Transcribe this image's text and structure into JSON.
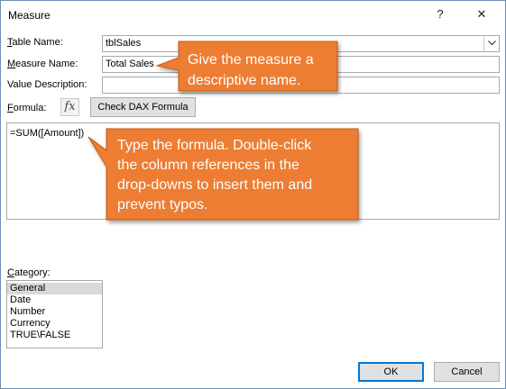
{
  "window": {
    "title": "Measure",
    "help_glyph": "?",
    "close_glyph": "✕"
  },
  "form": {
    "table_name": {
      "label_underlined": "T",
      "label_rest": "able Name:",
      "value": "tblSales"
    },
    "measure_name": {
      "label_underlined": "M",
      "label_rest": "easure Name:",
      "value": "Total Sales"
    },
    "value_description": {
      "label": "Value Description:",
      "value": ""
    },
    "formula": {
      "label_underlined": "F",
      "label_rest": "ormula:",
      "fx_glyph": "fx",
      "value": "=SUM([Amount])"
    },
    "check_dax": {
      "label_underlined": "h",
      "label_pre": "C",
      "label_rest": "eck DAX Formula"
    }
  },
  "category": {
    "label_underlined": "C",
    "label_rest": "ategory:",
    "items": [
      "General",
      "Date",
      "Number",
      "Currency",
      "TRUE\\FALSE"
    ],
    "selected": "General"
  },
  "buttons": {
    "ok": "OK",
    "cancel": "Cancel"
  },
  "callouts": {
    "measure_name": {
      "lines": [
        "Give the measure a",
        "descriptive name."
      ],
      "color": "#ed7d31"
    },
    "formula": {
      "lines": [
        "Type the formula.  Double-click",
        "the column references in the",
        "drop-downs to insert them and",
        "prevent typos."
      ],
      "color": "#ed7d31"
    }
  }
}
